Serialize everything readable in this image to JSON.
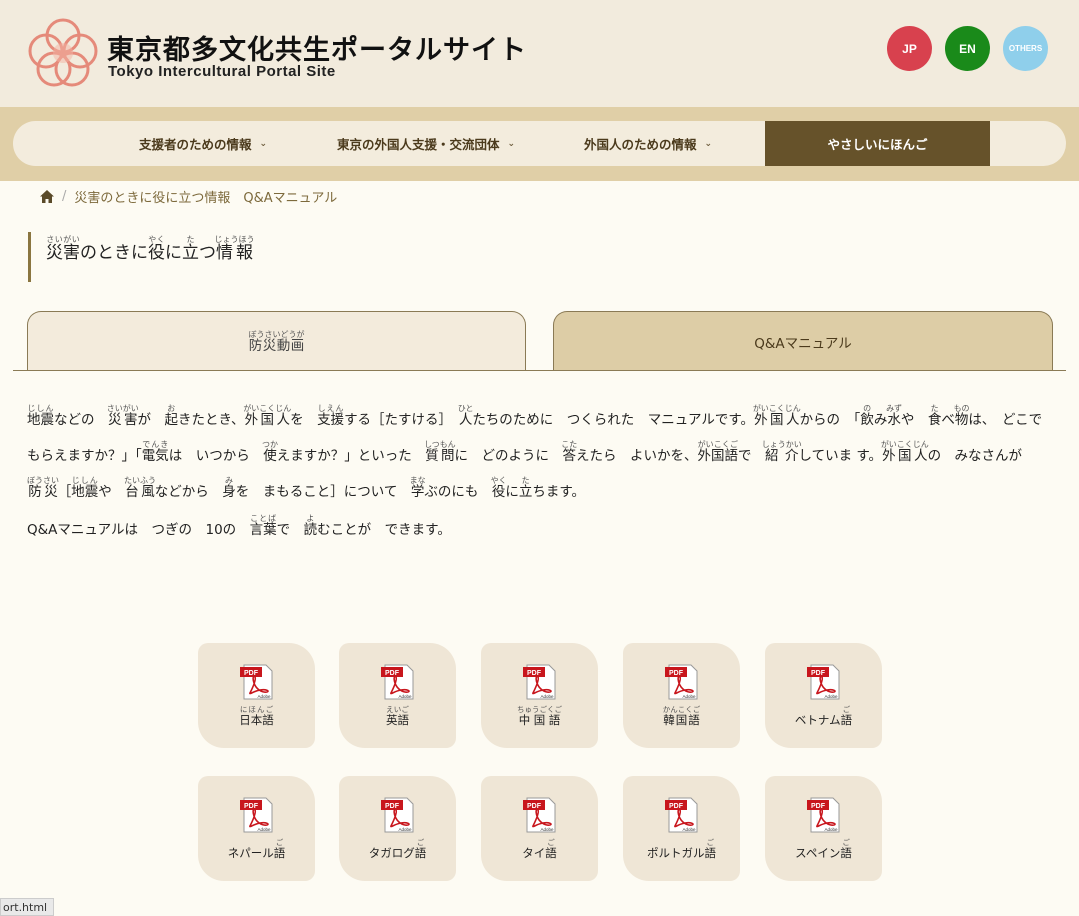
{
  "header": {
    "title_jp": "東京都多文化共生ポータルサイト",
    "title_en": "Tokyo Intercultural Portal Site",
    "languages": [
      {
        "label": "JP",
        "color": "#d8414e"
      },
      {
        "label": "EN",
        "color": "#1a8a1a"
      },
      {
        "label": "OTHERS",
        "color": "#8fcfeb"
      }
    ]
  },
  "nav": {
    "items": [
      {
        "label": "支援者のための情報",
        "icon": "chevron-down-icon"
      },
      {
        "label": "東京の外国人支援・交流団体",
        "icon": "chevron-down-icon"
      },
      {
        "label": "外国人のための情報",
        "icon": "chevron-down-icon"
      },
      {
        "label": "やさしいにほんご",
        "active": true
      }
    ],
    "active_color": "#66522a"
  },
  "breadcrumb": {
    "home_icon": "home-icon",
    "separator": "/",
    "current": "災害のときに役に立つ情報　Q&Aマニュアル"
  },
  "page_title": {
    "segments": [
      {
        "text": "災害",
        "ruby": "さいがい"
      },
      {
        "text": "のときに"
      },
      {
        "text": "役",
        "ruby": "やく"
      },
      {
        "text": "に"
      },
      {
        "text": "立",
        "ruby": "た"
      },
      {
        "text": "つ"
      },
      {
        "text": "情報",
        "ruby": "じょうほう"
      }
    ]
  },
  "tabs": [
    {
      "label": "防災動画",
      "ruby": "ぼうさいどうが"
    },
    {
      "label": "Q&Aマニュアル",
      "active": true
    }
  ],
  "description": {
    "segments": [
      {
        "text": "地震",
        "ruby": "じしん"
      },
      {
        "text": "などの　"
      },
      {
        "text": "災害",
        "ruby": "さいがい"
      },
      {
        "text": "が　"
      },
      {
        "text": "起",
        "ruby": "お"
      },
      {
        "text": "きたとき、"
      },
      {
        "text": "外国人",
        "ruby": "がいこくじん"
      },
      {
        "text": "を　"
      },
      {
        "text": "支援",
        "ruby": "しえん"
      },
      {
        "text": "する［たすける］　"
      },
      {
        "text": "人",
        "ruby": "ひと"
      },
      {
        "text": "たちのために　つくられた　マニュアルです。"
      },
      {
        "text": "外国人",
        "ruby": "がいこくじん"
      },
      {
        "text": "からの　「"
      },
      {
        "text": "飲",
        "ruby": "の"
      },
      {
        "text": "み"
      },
      {
        "text": "水",
        "ruby": "みず"
      },
      {
        "text": "や　"
      },
      {
        "text": "食",
        "ruby": "た"
      },
      {
        "text": "べ"
      },
      {
        "text": "物",
        "ruby": "もの"
      },
      {
        "text": "は、　どこで　もらえますか？」「"
      },
      {
        "text": "電気",
        "ruby": "でんき"
      },
      {
        "text": "は　いつから　"
      },
      {
        "text": "使",
        "ruby": "つか"
      },
      {
        "text": "えますか？」といった　"
      },
      {
        "text": "質問",
        "ruby": "しつもん"
      },
      {
        "text": "に　どのように　"
      },
      {
        "text": "答",
        "ruby": "こた"
      },
      {
        "text": "えたら　よいかを、"
      },
      {
        "text": "外国語",
        "ruby": "がいこくご"
      },
      {
        "text": "で　"
      },
      {
        "text": "紹介",
        "ruby": "しょうかい"
      },
      {
        "text": "していま す。"
      },
      {
        "text": "外国人",
        "ruby": "がいこくじん"
      },
      {
        "text": "の　みなさんが　"
      },
      {
        "text": "防災",
        "ruby": "ぼうさい"
      },
      {
        "text": "［"
      },
      {
        "text": "地震",
        "ruby": "じしん"
      },
      {
        "text": "や　"
      },
      {
        "text": "台風",
        "ruby": "たいふう"
      },
      {
        "text": "などから　"
      },
      {
        "text": "身",
        "ruby": "み"
      },
      {
        "text": "を　まもること］について　"
      },
      {
        "text": "学",
        "ruby": "まな"
      },
      {
        "text": "ぶのにも　"
      },
      {
        "text": "役",
        "ruby": "やく"
      },
      {
        "text": "に"
      },
      {
        "text": "立",
        "ruby": "た"
      },
      {
        "text": "ちます。"
      }
    ],
    "line2_segments": [
      {
        "text": "Q&Aマニュアルは　つぎの　10の　"
      },
      {
        "text": "言葉",
        "ruby": "ことば"
      },
      {
        "text": "で　"
      },
      {
        "text": "読",
        "ruby": "よ"
      },
      {
        "text": "むことが　できます。"
      }
    ]
  },
  "pdf_cards": [
    {
      "label": "日本語",
      "ruby": "にほんご",
      "icon": "pdf-icon"
    },
    {
      "label": "英語",
      "ruby": "えいご",
      "icon": "pdf-icon"
    },
    {
      "label": "中国語",
      "ruby": "ちゅうごくご",
      "icon": "pdf-icon"
    },
    {
      "label": "韓国語",
      "ruby": "かんこくご",
      "icon": "pdf-icon"
    },
    {
      "label": "ベトナム語",
      "ruby_on_last": "ご",
      "icon": "pdf-icon"
    },
    {
      "label": "ネパール語",
      "ruby_on_last": "ご",
      "icon": "pdf-icon"
    },
    {
      "label": "タガログ語",
      "ruby_on_last": "ご",
      "icon": "pdf-icon"
    },
    {
      "label": "タイ語",
      "ruby_on_last": "ご",
      "icon": "pdf-icon"
    },
    {
      "label": "ポルトガル語",
      "ruby_on_last": "ご",
      "icon": "pdf-icon"
    },
    {
      "label": "スペイン語",
      "ruby_on_last": "ご",
      "icon": "pdf-icon"
    }
  ],
  "pdf_icon_text": {
    "top": "PDF",
    "bottom": "Adobe"
  },
  "status_bar": "ort.html"
}
